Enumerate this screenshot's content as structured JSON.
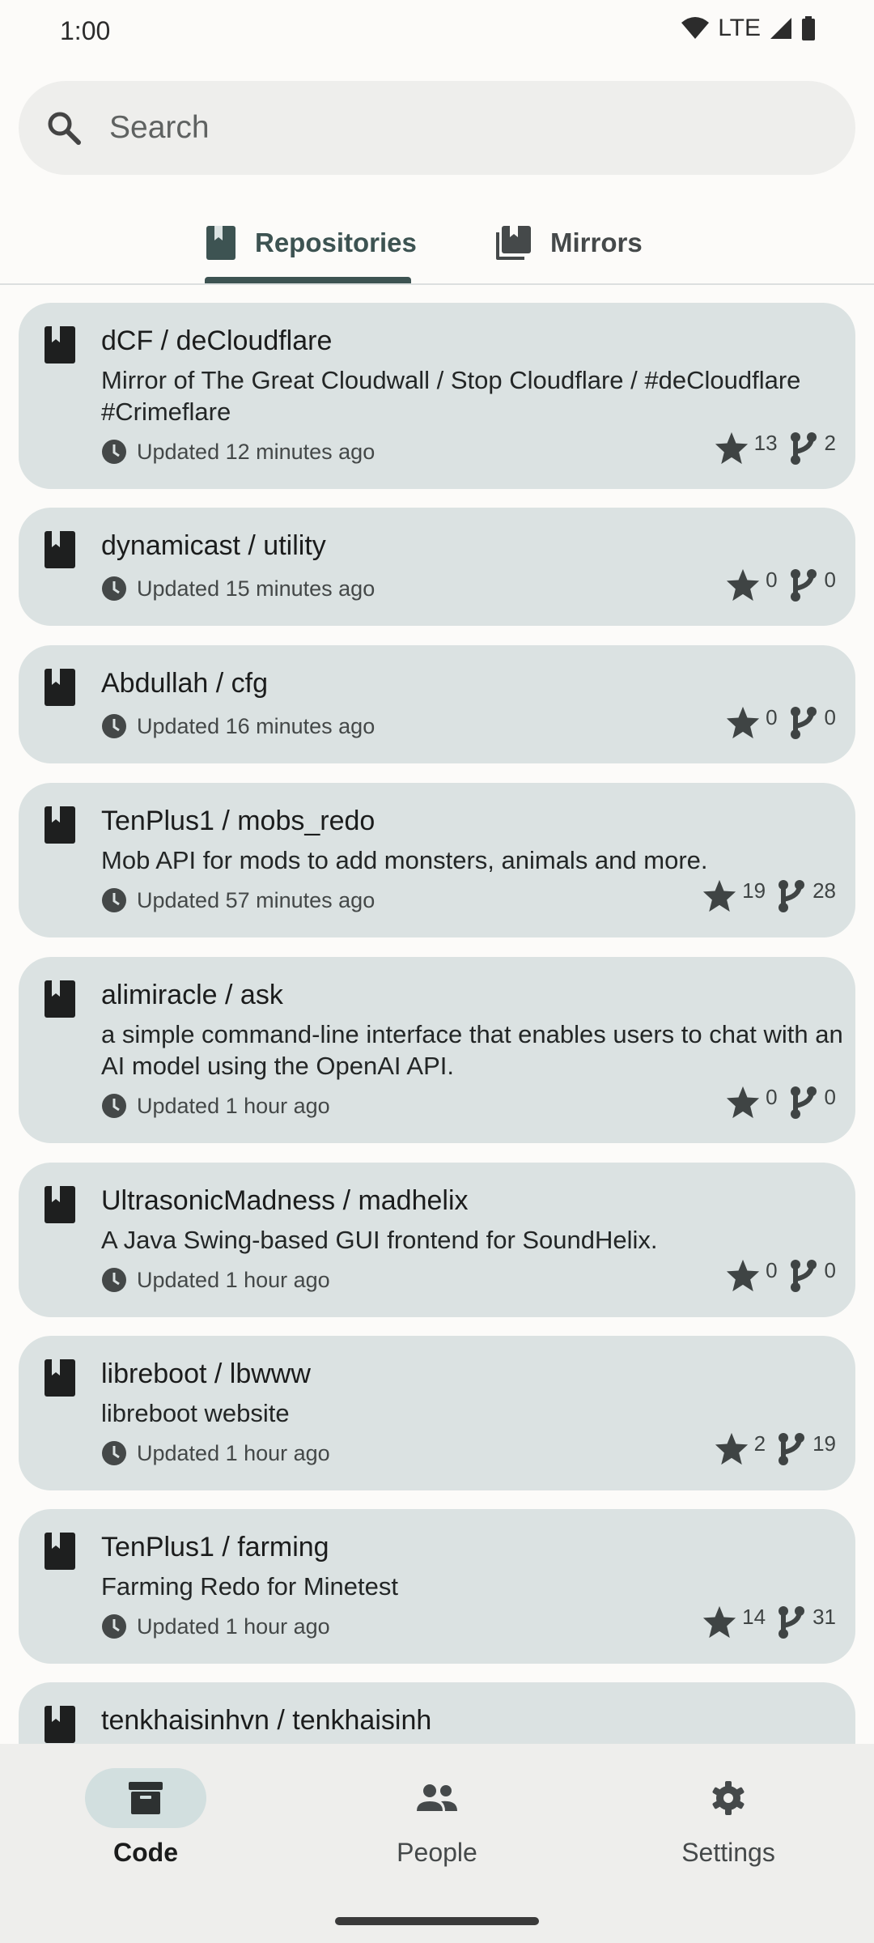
{
  "status_bar": {
    "time": "1:00",
    "network": "LTE"
  },
  "search": {
    "placeholder": "Search"
  },
  "tabs": [
    {
      "label": "Repositories",
      "active": true
    },
    {
      "label": "Mirrors",
      "active": false
    }
  ],
  "repositories": [
    {
      "title": "dCF / deCloudflare",
      "description": "Mirror of The Great Cloudwall / Stop Cloudflare / #deCloudflare #Crimeflare",
      "updated": "Updated 12 minutes ago",
      "stars": "13",
      "forks": "2"
    },
    {
      "title": "dynamicast / utility",
      "description": "",
      "updated": "Updated 15 minutes ago",
      "stars": "0",
      "forks": "0"
    },
    {
      "title": "Abdullah / cfg",
      "description": "",
      "updated": "Updated 16 minutes ago",
      "stars": "0",
      "forks": "0"
    },
    {
      "title": "TenPlus1 / mobs_redo",
      "description": "Mob API for mods to add monsters, animals and more.",
      "updated": "Updated 57 minutes ago",
      "stars": "19",
      "forks": "28"
    },
    {
      "title": "alimiracle / ask",
      "description": "a simple command-line interface that enables users to chat with an AI model using the OpenAI API.",
      "updated": "Updated 1 hour ago",
      "stars": "0",
      "forks": "0"
    },
    {
      "title": "UltrasonicMadness / madhelix",
      "description": "A Java Swing-based GUI frontend for SoundHelix.",
      "updated": "Updated 1 hour ago",
      "stars": "0",
      "forks": "0"
    },
    {
      "title": "libreboot / lbwww",
      "description": "libreboot website",
      "updated": "Updated 1 hour ago",
      "stars": "2",
      "forks": "19"
    },
    {
      "title": "TenPlus1 / farming",
      "description": "Farming Redo for Minetest",
      "updated": "Updated 1 hour ago",
      "stars": "14",
      "forks": "31"
    },
    {
      "title": "tenkhaisinhvn / tenkhaisinh",
      "description": "",
      "updated": "",
      "stars": "",
      "forks": ""
    }
  ],
  "bottom_nav": [
    {
      "label": "Code",
      "icon": "archive-icon",
      "active": true
    },
    {
      "label": "People",
      "icon": "people-icon",
      "active": false
    },
    {
      "label": "Settings",
      "icon": "gear-icon",
      "active": false
    }
  ],
  "colors": {
    "card": "#dbe2e2",
    "accent": "#3d5352",
    "nav_active_pill": "#d2dfdf"
  }
}
